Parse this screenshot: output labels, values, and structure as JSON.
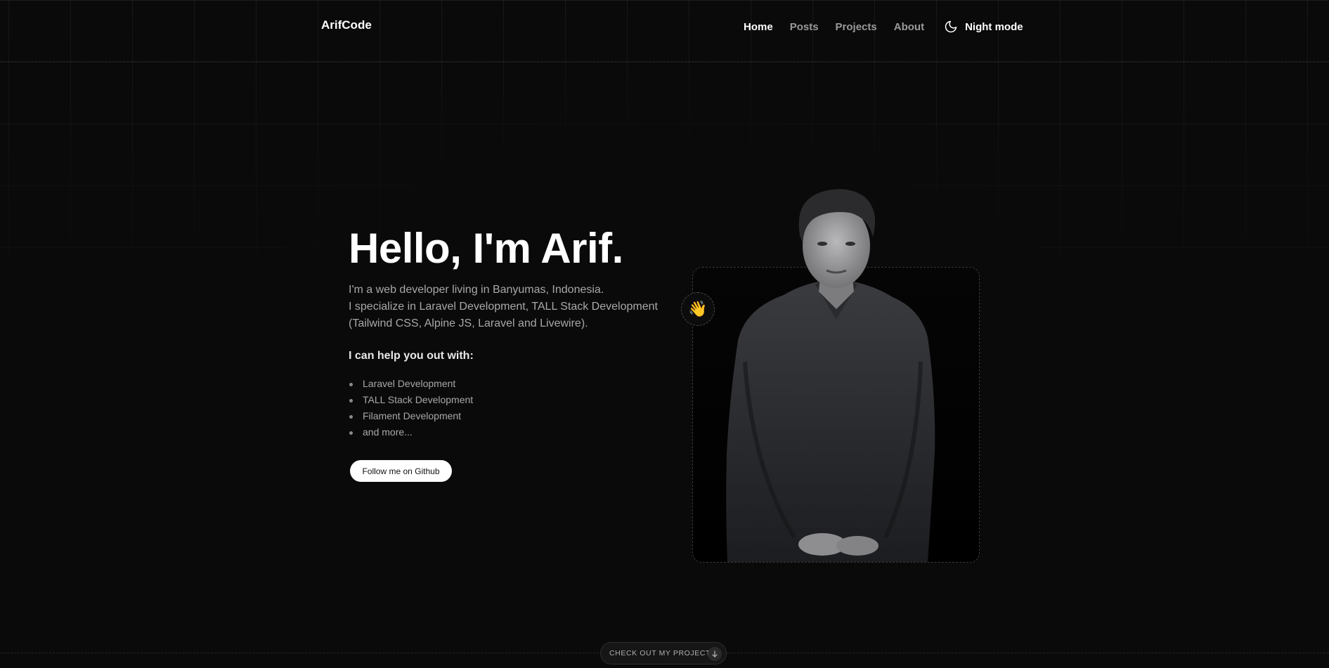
{
  "header": {
    "logo": "ArifCode",
    "nav": [
      {
        "label": "Home",
        "active": true
      },
      {
        "label": "Posts",
        "active": false
      },
      {
        "label": "Projects",
        "active": false
      },
      {
        "label": "About",
        "active": false
      }
    ],
    "night_mode_label": "Night mode",
    "night_mode_icon": "moon-icon"
  },
  "hero": {
    "title": "Hello, I'm Arif.",
    "description_lines": [
      "I'm a web developer living in Banyumas, Indonesia.",
      "I specialize in Laravel Development, TALL Stack Development",
      "(Tailwind CSS, Alpine JS, Laravel and Livewire)."
    ],
    "help_heading": "I can help you out with:",
    "services": [
      "Laravel Development",
      "TALL Stack Development",
      "Filament Development",
      "and more..."
    ],
    "github_button": "Follow me on Github",
    "wave_emoji": "👋"
  },
  "footer": {
    "projects_cta": "CHECK OUT MY PROJECTS",
    "arrow_icon": "arrow-down-icon"
  },
  "colors": {
    "background": "#0a0a0a",
    "text_primary": "#ffffff",
    "text_muted": "#a8a8a8",
    "button_bg": "#ffffff"
  }
}
